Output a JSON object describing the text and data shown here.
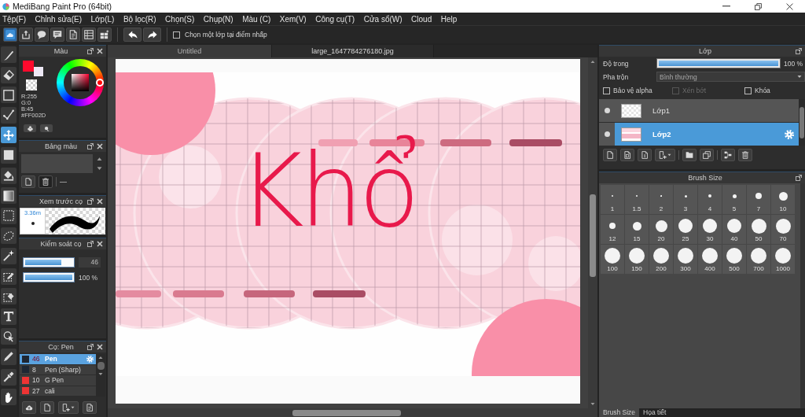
{
  "window": {
    "title": "MediBang Paint Pro (64bit)"
  },
  "menu": [
    "Tệp(F)",
    "Chỉnh sửa(E)",
    "Lớp(L)",
    "Bộ lọc(R)",
    "Chọn(S)",
    "Chụp(N)",
    "Màu (C)",
    "Xem(V)",
    "Công cụ(T)",
    "Cửa sổ(W)",
    "Cloud",
    "Help"
  ],
  "toolbar": {
    "option": {
      "label": "Chọn một lớp tại điểm nhấp",
      "checked": false
    }
  },
  "tools": [
    {
      "kind": "brush",
      "selected": false
    },
    {
      "kind": "eraser",
      "selected": false
    },
    {
      "kind": "rectangle",
      "selected": false
    },
    {
      "kind": "polyline",
      "selected": false
    },
    {
      "kind": "move",
      "selected": true
    },
    {
      "kind": "fill",
      "selected": false
    },
    {
      "kind": "bucket",
      "selected": false
    },
    {
      "kind": "gradient",
      "selected": false
    },
    {
      "kind": "marquee",
      "selected": false
    },
    {
      "kind": "lasso",
      "selected": false
    },
    {
      "kind": "wand",
      "selected": false
    },
    {
      "kind": "selectpen",
      "selected": false
    },
    {
      "kind": "selecteraser",
      "selected": false
    },
    {
      "kind": "text",
      "selected": false
    },
    {
      "kind": "operation",
      "selected": false
    },
    {
      "kind": "pen",
      "selected": false
    },
    {
      "kind": "dropper",
      "selected": false
    },
    {
      "kind": "hand",
      "selected": false
    }
  ],
  "color_panel": {
    "title": "Màu",
    "swatches": [
      {
        "color": "#ff0a2d"
      },
      {
        "color": "#ece8f5"
      }
    ],
    "channels": [
      "R:255",
      "G:0",
      "B:45"
    ],
    "hex": "#FF002D"
  },
  "palette_panel": {
    "title": "Bảng màu",
    "palette_name": "—"
  },
  "preview_panel": {
    "title": "Xem trước cọ",
    "size": "3.36m"
  },
  "brush_control": {
    "title": "Kiểm soát cọ",
    "sliders": [
      {
        "kind": "field",
        "level": 0.77,
        "reading": "46"
      },
      {
        "kind": "plain",
        "level": 1,
        "reading": "100 %"
      }
    ]
  },
  "brush_panel": {
    "title": "Cọ: Pen",
    "brushes": [
      {
        "color": "#1e2733",
        "size": "46",
        "name": "Pen",
        "selected": true
      },
      {
        "color": "#1e2733",
        "size": "8",
        "name": "Pen (Sharp)",
        "selected": false
      },
      {
        "color": "#ee3434",
        "size": "10",
        "name": "G Pen",
        "selected": false
      },
      {
        "color": "#ee3434",
        "size": "27",
        "name": "cali",
        "selected": false
      }
    ]
  },
  "canvas": {
    "tabs": [
      {
        "label": "Untitled",
        "selected": false
      },
      {
        "label": "large_1647784276180.jpg",
        "selected": true
      }
    ],
    "lettering": "Khổ"
  },
  "layer_panel": {
    "title": "Lớp",
    "opacity": {
      "label": "Độ trong",
      "level": 1,
      "reading": "100 %"
    },
    "blend": {
      "label": "Pha trộn",
      "value": "Bình thường"
    },
    "options": [
      {
        "label": "Bảo vệ alpha",
        "checked": false,
        "disabled": false
      },
      {
        "label": "Xén bớt",
        "checked": false,
        "disabled": true
      },
      {
        "label": "Khóa",
        "checked": false,
        "disabled": false
      }
    ],
    "layers": [
      {
        "name": "Lớp1",
        "visible": true,
        "selected": false
      },
      {
        "name": "Lớp2",
        "visible": true,
        "selected": true
      }
    ]
  },
  "brush_size_panel": {
    "title": "Brush Size",
    "sizes": [
      "1",
      "1.5",
      "2",
      "3",
      "4",
      "5",
      "7",
      "10",
      "12",
      "15",
      "20",
      "25",
      "30",
      "40",
      "50",
      "70",
      "100",
      "150",
      "200",
      "300",
      "400",
      "500",
      "700",
      "1000"
    ]
  },
  "dock_tabs": [
    {
      "label": "Brush Size",
      "selected": true
    },
    {
      "label": "Họa tiết",
      "selected": false
    }
  ]
}
